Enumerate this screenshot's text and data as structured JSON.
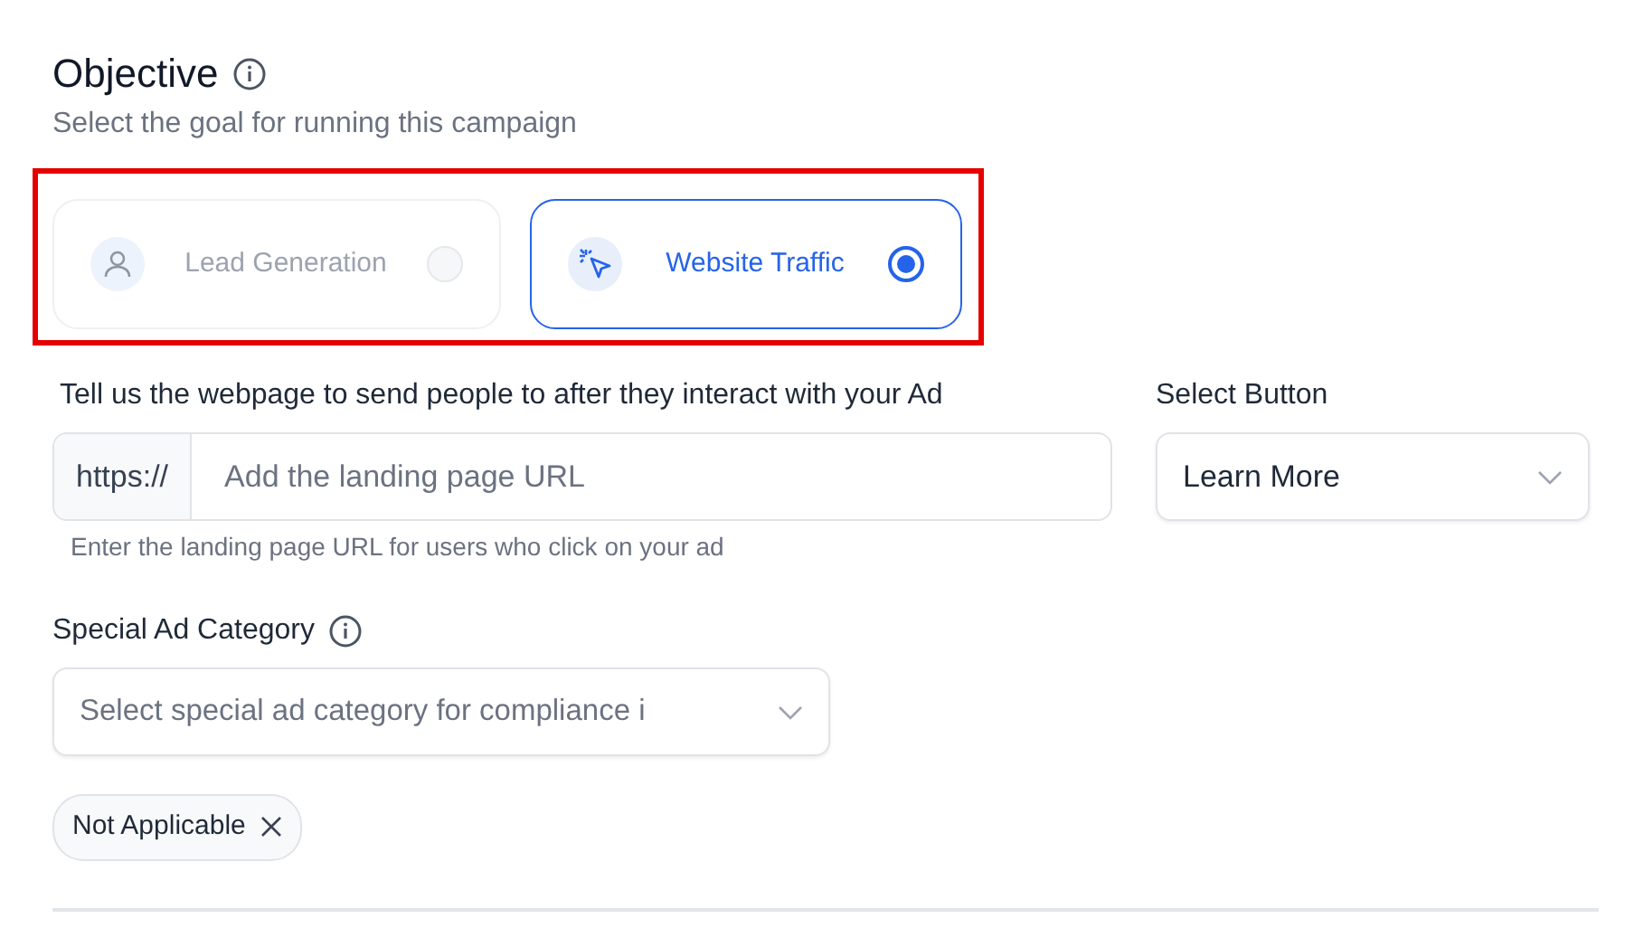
{
  "objective": {
    "title": "Objective",
    "subtitle": "Select the goal for running this campaign",
    "highlight": true,
    "options": [
      {
        "label": "Lead Generation",
        "kind": "person",
        "selected": false,
        "disabled": true
      },
      {
        "label": "Website Traffic",
        "kind": "cursor",
        "selected": true,
        "disabled": false
      }
    ]
  },
  "url": {
    "label": "Tell us the webpage to send people to after they interact with your Ad",
    "prefix": "https://",
    "placeholder": "Add the landing page URL",
    "hint": "Enter the landing page URL for users who click on your ad"
  },
  "button_select": {
    "label": "Select Button",
    "value": "Learn More"
  },
  "special_category": {
    "label": "Special Ad Category",
    "placeholder": "Select special ad category for compliance i",
    "chips": [
      {
        "label": "Not Applicable"
      }
    ]
  }
}
